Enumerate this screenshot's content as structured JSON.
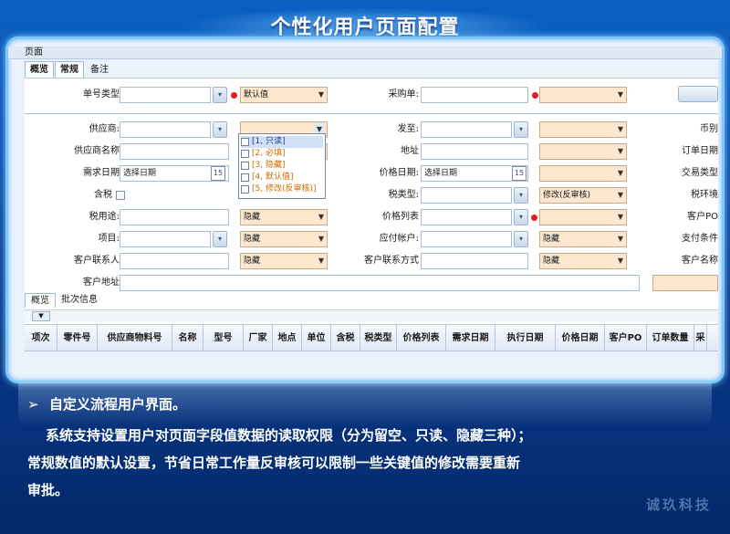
{
  "slide": {
    "title": "个性化用户页面配置",
    "bullet": "自定义流程用户界面。",
    "para_line1": "系统支持设置用户对页面字段值数据的读取权限（分为留空、只读、隐藏三种）；",
    "para_line2": "常规数值的默认设置，节省日常工作量反审核可以限制一些关键值的修改需要重新",
    "para_line3": "审批。",
    "brand": "诚玖科技"
  },
  "window": {
    "title": "页面",
    "tabs": [
      "概览",
      "常规",
      "备注"
    ]
  },
  "form": {
    "labels": {
      "order_type": "单号类型",
      "purchase_no": "采购单:",
      "supplier": "供应商:",
      "ship_to": "发至:",
      "currency": "币别",
      "supplier_name": "供应商名称",
      "address": "地址",
      "order_date": "订单日期",
      "demand_date": "需求日期",
      "price_date": "价格日期:",
      "trade_type": "交易类型",
      "tax_incl": "含税",
      "tax_type": "税类型:",
      "tax_env": "税环境",
      "tax_use": "税用途:",
      "price_list": "价格列表",
      "customer_po": "客户PO",
      "item": "项目:",
      "pay_account": "应付帐户:",
      "pay_terms": "支付条件",
      "cust_contact": "客户联系人",
      "cust_contact_method": "客户联系方式",
      "cust_name": "客户名称",
      "cust_address": "客户地址"
    },
    "values": {
      "default": "默认值",
      "select_date": "选择日期",
      "hidden": "隐藏",
      "modify_reaudit": "修改(反审核)"
    },
    "calendar_day": "15",
    "dropdown_options": [
      "[1, 只读]",
      "[2, 必填]",
      "[3, 隐藏]",
      "[4, 默认值]",
      "[5, 修改(反审核)]"
    ]
  },
  "detail": {
    "tabs": [
      "概览",
      "批次信息"
    ],
    "columns": [
      "项次",
      "零件号",
      "供应商物料号",
      "名称",
      "型号",
      "厂家",
      "地点",
      "单位",
      "含税",
      "税类型",
      "价格列表",
      "需求日期",
      "执行日期",
      "价格日期",
      "客户PO",
      "订单数量",
      "采"
    ]
  },
  "colors": {
    "accent": "#0a4fae",
    "required_dot": "#e51c1c",
    "config_field": "#fde7cf",
    "dropdown_text": "#d06a00"
  }
}
